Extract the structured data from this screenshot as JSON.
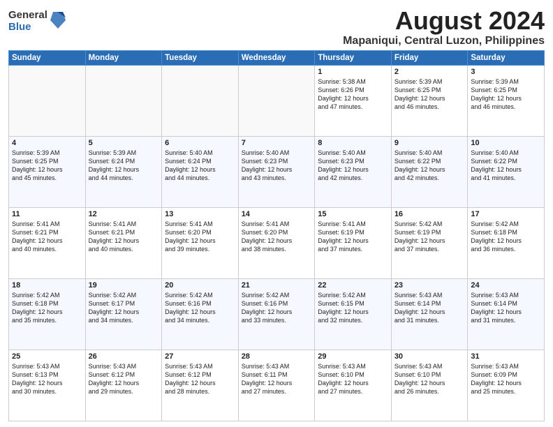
{
  "logo": {
    "general": "General",
    "blue": "Blue"
  },
  "title": "August 2024",
  "location": "Mapaniqui, Central Luzon, Philippines",
  "days_of_week": [
    "Sunday",
    "Monday",
    "Tuesday",
    "Wednesday",
    "Thursday",
    "Friday",
    "Saturday"
  ],
  "weeks": [
    [
      {
        "day": "",
        "info": ""
      },
      {
        "day": "",
        "info": ""
      },
      {
        "day": "",
        "info": ""
      },
      {
        "day": "",
        "info": ""
      },
      {
        "day": "1",
        "info": "Sunrise: 5:38 AM\nSunset: 6:26 PM\nDaylight: 12 hours\nand 47 minutes."
      },
      {
        "day": "2",
        "info": "Sunrise: 5:39 AM\nSunset: 6:25 PM\nDaylight: 12 hours\nand 46 minutes."
      },
      {
        "day": "3",
        "info": "Sunrise: 5:39 AM\nSunset: 6:25 PM\nDaylight: 12 hours\nand 46 minutes."
      }
    ],
    [
      {
        "day": "4",
        "info": "Sunrise: 5:39 AM\nSunset: 6:25 PM\nDaylight: 12 hours\nand 45 minutes."
      },
      {
        "day": "5",
        "info": "Sunrise: 5:39 AM\nSunset: 6:24 PM\nDaylight: 12 hours\nand 44 minutes."
      },
      {
        "day": "6",
        "info": "Sunrise: 5:40 AM\nSunset: 6:24 PM\nDaylight: 12 hours\nand 44 minutes."
      },
      {
        "day": "7",
        "info": "Sunrise: 5:40 AM\nSunset: 6:23 PM\nDaylight: 12 hours\nand 43 minutes."
      },
      {
        "day": "8",
        "info": "Sunrise: 5:40 AM\nSunset: 6:23 PM\nDaylight: 12 hours\nand 42 minutes."
      },
      {
        "day": "9",
        "info": "Sunrise: 5:40 AM\nSunset: 6:22 PM\nDaylight: 12 hours\nand 42 minutes."
      },
      {
        "day": "10",
        "info": "Sunrise: 5:40 AM\nSunset: 6:22 PM\nDaylight: 12 hours\nand 41 minutes."
      }
    ],
    [
      {
        "day": "11",
        "info": "Sunrise: 5:41 AM\nSunset: 6:21 PM\nDaylight: 12 hours\nand 40 minutes."
      },
      {
        "day": "12",
        "info": "Sunrise: 5:41 AM\nSunset: 6:21 PM\nDaylight: 12 hours\nand 40 minutes."
      },
      {
        "day": "13",
        "info": "Sunrise: 5:41 AM\nSunset: 6:20 PM\nDaylight: 12 hours\nand 39 minutes."
      },
      {
        "day": "14",
        "info": "Sunrise: 5:41 AM\nSunset: 6:20 PM\nDaylight: 12 hours\nand 38 minutes."
      },
      {
        "day": "15",
        "info": "Sunrise: 5:41 AM\nSunset: 6:19 PM\nDaylight: 12 hours\nand 37 minutes."
      },
      {
        "day": "16",
        "info": "Sunrise: 5:42 AM\nSunset: 6:19 PM\nDaylight: 12 hours\nand 37 minutes."
      },
      {
        "day": "17",
        "info": "Sunrise: 5:42 AM\nSunset: 6:18 PM\nDaylight: 12 hours\nand 36 minutes."
      }
    ],
    [
      {
        "day": "18",
        "info": "Sunrise: 5:42 AM\nSunset: 6:18 PM\nDaylight: 12 hours\nand 35 minutes."
      },
      {
        "day": "19",
        "info": "Sunrise: 5:42 AM\nSunset: 6:17 PM\nDaylight: 12 hours\nand 34 minutes."
      },
      {
        "day": "20",
        "info": "Sunrise: 5:42 AM\nSunset: 6:16 PM\nDaylight: 12 hours\nand 34 minutes."
      },
      {
        "day": "21",
        "info": "Sunrise: 5:42 AM\nSunset: 6:16 PM\nDaylight: 12 hours\nand 33 minutes."
      },
      {
        "day": "22",
        "info": "Sunrise: 5:42 AM\nSunset: 6:15 PM\nDaylight: 12 hours\nand 32 minutes."
      },
      {
        "day": "23",
        "info": "Sunrise: 5:43 AM\nSunset: 6:14 PM\nDaylight: 12 hours\nand 31 minutes."
      },
      {
        "day": "24",
        "info": "Sunrise: 5:43 AM\nSunset: 6:14 PM\nDaylight: 12 hours\nand 31 minutes."
      }
    ],
    [
      {
        "day": "25",
        "info": "Sunrise: 5:43 AM\nSunset: 6:13 PM\nDaylight: 12 hours\nand 30 minutes."
      },
      {
        "day": "26",
        "info": "Sunrise: 5:43 AM\nSunset: 6:12 PM\nDaylight: 12 hours\nand 29 minutes."
      },
      {
        "day": "27",
        "info": "Sunrise: 5:43 AM\nSunset: 6:12 PM\nDaylight: 12 hours\nand 28 minutes."
      },
      {
        "day": "28",
        "info": "Sunrise: 5:43 AM\nSunset: 6:11 PM\nDaylight: 12 hours\nand 27 minutes."
      },
      {
        "day": "29",
        "info": "Sunrise: 5:43 AM\nSunset: 6:10 PM\nDaylight: 12 hours\nand 27 minutes."
      },
      {
        "day": "30",
        "info": "Sunrise: 5:43 AM\nSunset: 6:10 PM\nDaylight: 12 hours\nand 26 minutes."
      },
      {
        "day": "31",
        "info": "Sunrise: 5:43 AM\nSunset: 6:09 PM\nDaylight: 12 hours\nand 25 minutes."
      }
    ]
  ]
}
